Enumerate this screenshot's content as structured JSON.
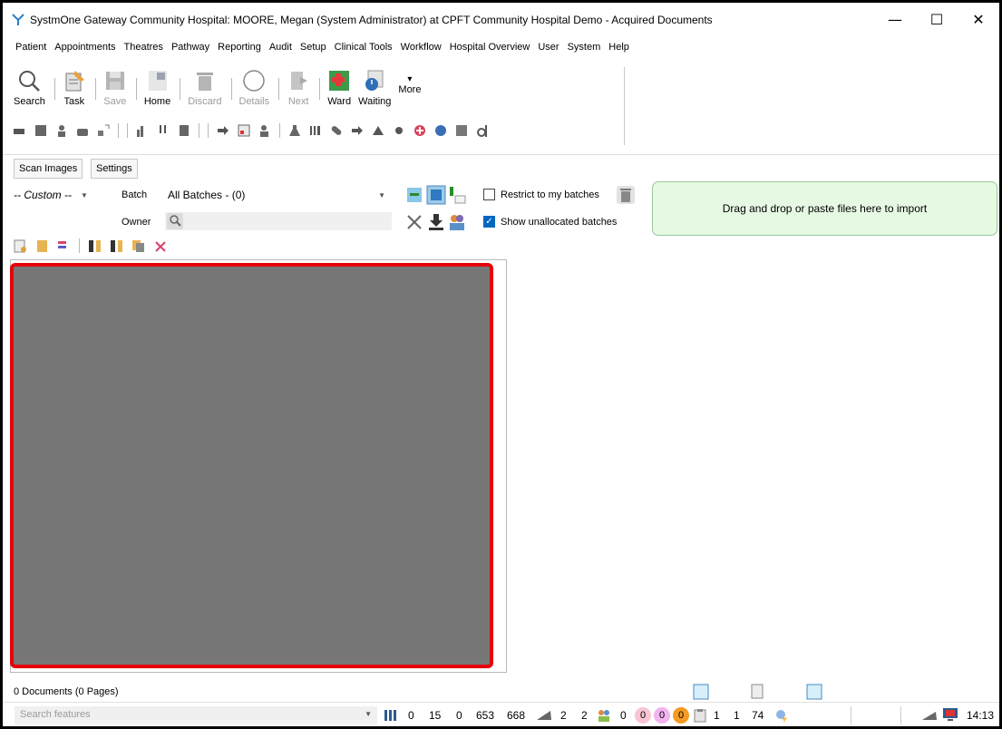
{
  "window": {
    "title": "SystmOne Gateway Community Hospital: MOORE, Megan (System Administrator) at CPFT Community Hospital Demo - Acquired Documents",
    "minimize": "—",
    "maximize": "☐",
    "close": "✕"
  },
  "menu": [
    "Patient",
    "Appointments",
    "Theatres",
    "Pathway",
    "Reporting",
    "Audit",
    "Setup",
    "Clinical Tools",
    "Workflow",
    "Hospital Overview",
    "User",
    "System",
    "Help"
  ],
  "toolbar": {
    "search": "Search",
    "task": "Task",
    "save": "Save",
    "home": "Home",
    "discard": "Discard",
    "details": "Details",
    "next": "Next",
    "ward": "Ward",
    "waiting": "Waiting",
    "more": "More",
    "more_arrow": "▾"
  },
  "tabs": {
    "scan_images": "Scan Images",
    "settings": "Settings"
  },
  "filters": {
    "custom": "-- Custom --",
    "batch_label": "Batch",
    "batch_value": "All Batches - (0)",
    "owner_label": "Owner",
    "restrict_label": "Restrict to my batches",
    "restrict_checked": false,
    "show_unallocated_label": "Show unallocated batches",
    "show_unallocated_checked": true
  },
  "dropzone": {
    "text": "Drag and drop or paste files here to import"
  },
  "status": {
    "doc_count": "0 Documents (0 Pages)",
    "search_placeholder": "Search features",
    "s1": "0",
    "s2": "15",
    "s3": "0",
    "s4": "653",
    "s5": "668",
    "s6": "2",
    "s7": "2",
    "s8": "0",
    "b_pink1": "0",
    "b_pink2": "0",
    "b_orange": "0",
    "s9": "1",
    "s10": "1",
    "s11": "74",
    "time": "14:13"
  }
}
